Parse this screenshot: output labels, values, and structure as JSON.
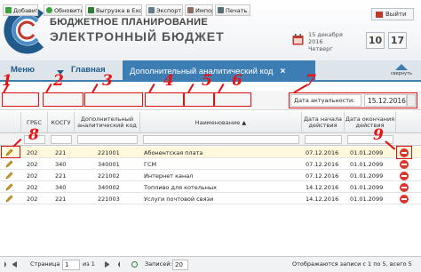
{
  "header": {
    "brand_line1": "БЮДЖЕТНОЕ ПЛАНИРОВАНИЕ",
    "brand_line2": "ЭЛЕКТРОННЫЙ БЮДЖЕТ",
    "exit_label": "Выйти",
    "date_line1": "15 декабря",
    "date_line2": "2016",
    "date_line3": "Четверг",
    "hour": "10",
    "minute": "17"
  },
  "nav": {
    "menu_label": "Меню",
    "main_label": "Главная",
    "tab_label": "Дополнительный аналитический код",
    "tab_close": "×",
    "collapse_label": "свернуть"
  },
  "toolbar": {
    "add_label": "Добавить",
    "refresh_label": "Обновить",
    "upload_label": "Выгрузка в Exce",
    "export_label": "Экспорт",
    "import_label": "Импорт",
    "print_label": "Печать",
    "relevance_date_label": "Дата актуальности:",
    "relevance_date_value": "15.12.2016"
  },
  "table": {
    "columns": [
      "ГРБС",
      "КОСГУ",
      "Дополнительный аналитический код",
      "Наименование ▲",
      "Дата начала действия",
      "Дата окончания действия"
    ],
    "rows": [
      {
        "grbs": "202",
        "kosgu": "221",
        "code": "221001",
        "name": "Абонентская плата",
        "start": "07.12.2016",
        "end": "01.01.2099"
      },
      {
        "grbs": "202",
        "kosgu": "340",
        "code": "340001",
        "name": "ГСМ",
        "start": "07.12.2016",
        "end": "01.01.2099"
      },
      {
        "grbs": "202",
        "kosgu": "221",
        "code": "221002",
        "name": "Интернет канал",
        "start": "07.12.2016",
        "end": "01.01.2099"
      },
      {
        "grbs": "202",
        "kosgu": "340",
        "code": "340002",
        "name": "Топливо для котельных",
        "start": "14.12.2016",
        "end": "01.01.2099"
      },
      {
        "grbs": "202",
        "kosgu": "221",
        "code": "221003",
        "name": "Услуги почтовой связи",
        "start": "14.12.2016",
        "end": "01.01.2099"
      }
    ]
  },
  "footer": {
    "page_label": "Страница",
    "page_value": "1",
    "of_label": "из 1",
    "records_label": "Записей:",
    "records_value": "20",
    "summary": "Отображаются записи с 1 по 5, всего 5"
  },
  "annotations": [
    "1",
    "2",
    "3",
    "4",
    "5",
    "6",
    "7",
    "8",
    "9"
  ],
  "colors": {
    "accent": "#3c7db3",
    "annotation": "#dd1111",
    "delete": "#d9362b",
    "nav_text": "#1f5a8a"
  }
}
